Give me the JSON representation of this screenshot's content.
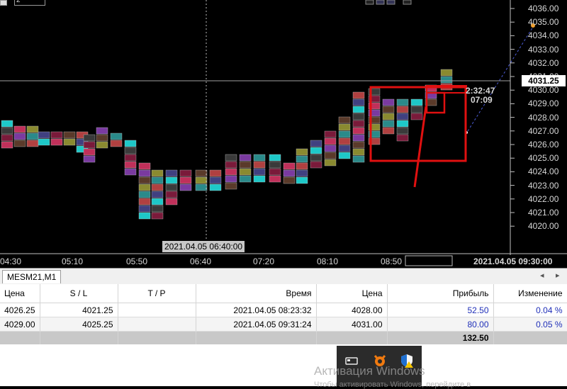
{
  "toolbar": {
    "chart_mode": "2"
  },
  "price_axis": {
    "labels": [
      "4036.00",
      "4035.00",
      "4034.00",
      "4033.00",
      "4032.00",
      "4031.00",
      "4030.00",
      "4029.00",
      "4028.00",
      "4027.00",
      "4026.00",
      "4025.00",
      "4024.00",
      "4023.00",
      "4022.00",
      "4021.00",
      "4020.00"
    ],
    "current_price": "4031.25"
  },
  "time_axis": {
    "labels": [
      "04:30",
      "05:10",
      "05:50",
      "06:40",
      "07:20",
      "08:10",
      "08:50"
    ],
    "crosshair_time": "2021.04.05 06:40:00",
    "right_time": "2021.04.05 09:30:00"
  },
  "overlay": {
    "timer": "2:32:47",
    "timer2": "07:09"
  },
  "colors": {
    "background": "#000000",
    "marker_red": "#e01010",
    "positive": "#1f2fb8"
  },
  "tab": {
    "symbol": "MESM21,M1",
    "nav_left": "◂",
    "nav_right": "▸"
  },
  "table": {
    "headers": [
      "Цена",
      "S / L",
      "T / P",
      "Время",
      "Цена",
      "Прибыль",
      "Изменение"
    ],
    "rows": [
      {
        "price_open": "4026.25",
        "sl": "4021.25",
        "tp": "",
        "time": "2021.04.05 08:23:32",
        "price": "4028.00",
        "profit": "52.50",
        "change": "0.04 %"
      },
      {
        "price_open": "4029.00",
        "sl": "4025.25",
        "tp": "",
        "time": "2021.04.05 09:31:24",
        "price": "4031.00",
        "profit": "80.00",
        "change": "0.05 %"
      }
    ],
    "total": "132.50"
  },
  "watermark": {
    "title": "Активация Windows",
    "subtitle": "Чтобы активировать Windows, перейдите в"
  },
  "tray_icons": [
    "network-icon",
    "avast-icon",
    "shield-warning-icon"
  ]
}
